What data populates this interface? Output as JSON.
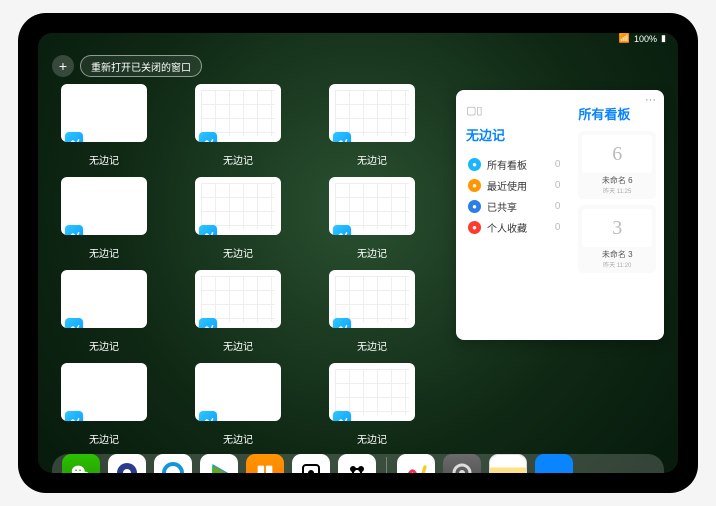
{
  "status": {
    "percent": "100%"
  },
  "toolbar": {
    "add": "+",
    "reopen_label": "重新打开已关闭的窗口"
  },
  "thumb_label": "无边记",
  "thumbs": [
    {
      "style": "blank"
    },
    {
      "style": "grid"
    },
    {
      "style": "grid"
    },
    {
      "style": "blank"
    },
    {
      "style": "grid"
    },
    {
      "style": "grid"
    },
    {
      "style": "blank"
    },
    {
      "style": "grid"
    },
    {
      "style": "grid"
    },
    {
      "style": "blank"
    },
    {
      "style": "blank"
    },
    {
      "style": "grid"
    }
  ],
  "panel": {
    "title": "无边记",
    "more": "···",
    "nav": [
      {
        "label": "所有看板",
        "count": "0",
        "color": "#19b5fe"
      },
      {
        "label": "最近使用",
        "count": "0",
        "color": "#ff9500"
      },
      {
        "label": "已共享",
        "count": "0",
        "color": "#2b7de9"
      },
      {
        "label": "个人收藏",
        "count": "0",
        "color": "#ff3b30"
      }
    ],
    "right_title": "所有看板",
    "boards": [
      {
        "name": "未命名 6",
        "time": "昨天 11:25",
        "sketch": "6"
      },
      {
        "name": "未命名 3",
        "time": "昨天 11:20",
        "sketch": "3"
      }
    ]
  },
  "dock": [
    {
      "id": "wechat"
    },
    {
      "id": "quark"
    },
    {
      "id": "qqbrowser"
    },
    {
      "id": "tencent-video"
    },
    {
      "id": "books"
    },
    {
      "id": "roll"
    },
    {
      "id": "bear"
    },
    {
      "id": "divider"
    },
    {
      "id": "freeform"
    },
    {
      "id": "settings"
    },
    {
      "id": "notes"
    },
    {
      "id": "app-library"
    }
  ]
}
